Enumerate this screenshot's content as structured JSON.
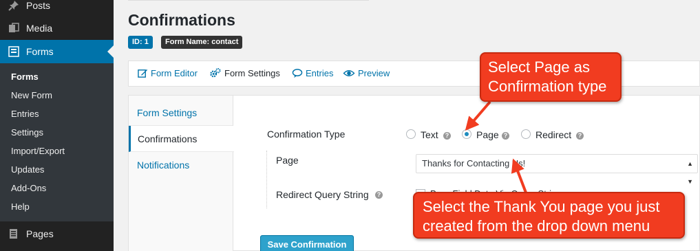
{
  "sidebar": {
    "posts": "Posts",
    "media": "Media",
    "forms": "Forms",
    "submenu": [
      "Forms",
      "New Form",
      "Entries",
      "Settings",
      "Import/Export",
      "Updates",
      "Add-Ons",
      "Help"
    ],
    "pages": "Pages"
  },
  "header": {
    "title": "Confirmations",
    "id_badge": "ID: 1",
    "name_badge": "Form Name: contact"
  },
  "toolbar": {
    "form_editor": "Form Editor",
    "form_settings": "Form Settings",
    "entries": "Entries",
    "preview": "Preview"
  },
  "tabs": [
    "Form Settings",
    "Confirmations",
    "Notifications"
  ],
  "confirmation": {
    "type_label": "Confirmation Type",
    "options": [
      "Text",
      "Page",
      "Redirect"
    ],
    "selected": "Page",
    "page_label": "Page",
    "page_value": "Thanks for Contacting Us!",
    "query_label": "Redirect Query String",
    "query_checkbox_label": "Pass Field Data Via Query String",
    "help_symbol": "?",
    "save_label": "Save Confirmation"
  },
  "annotations": {
    "callout_1_line1": "Select Page as",
    "callout_1_line2": "Confirmation type",
    "callout_2_line1": "Select the Thank You page you just",
    "callout_2_line2": "created from the drop down menu"
  },
  "colors": {
    "admin_blue": "#0073aa",
    "callout_red": "#f13c20",
    "button_blue": "#2ea2cc"
  }
}
